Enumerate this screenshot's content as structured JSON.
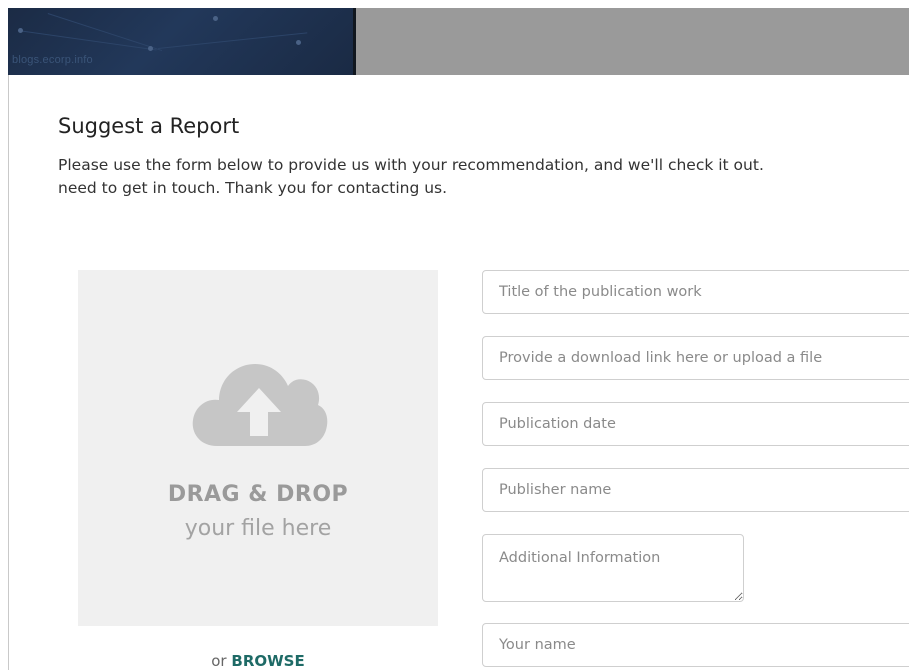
{
  "header": {
    "brand_text": "blogs.ecorp.info"
  },
  "page": {
    "title": "Suggest a Report",
    "description_line1": "Please use the form below to provide us with your recommendation, and we'll check it out.",
    "description_line2": "need to get in touch. Thank you for contacting us."
  },
  "dropzone": {
    "icon": "cloud-upload-icon",
    "title": "DRAG & DROP",
    "subtitle": "your file here",
    "browse_prefix": "or",
    "browse_label": "BROWSE"
  },
  "form": {
    "title_placeholder": "Title of the publication work",
    "link_placeholder": "Provide a download link here or upload a file",
    "date_placeholder": "Publication date",
    "publisher_placeholder": "Publisher name",
    "info_placeholder": "Additional Information",
    "name_placeholder": "Your name"
  },
  "colors": {
    "header_dark": "#1b2b45",
    "header_gray": "#9a9a9a",
    "dropzone_bg": "#f0f0f0",
    "icon_gray": "#c6c6c6",
    "link_accent": "#1e6a66"
  }
}
